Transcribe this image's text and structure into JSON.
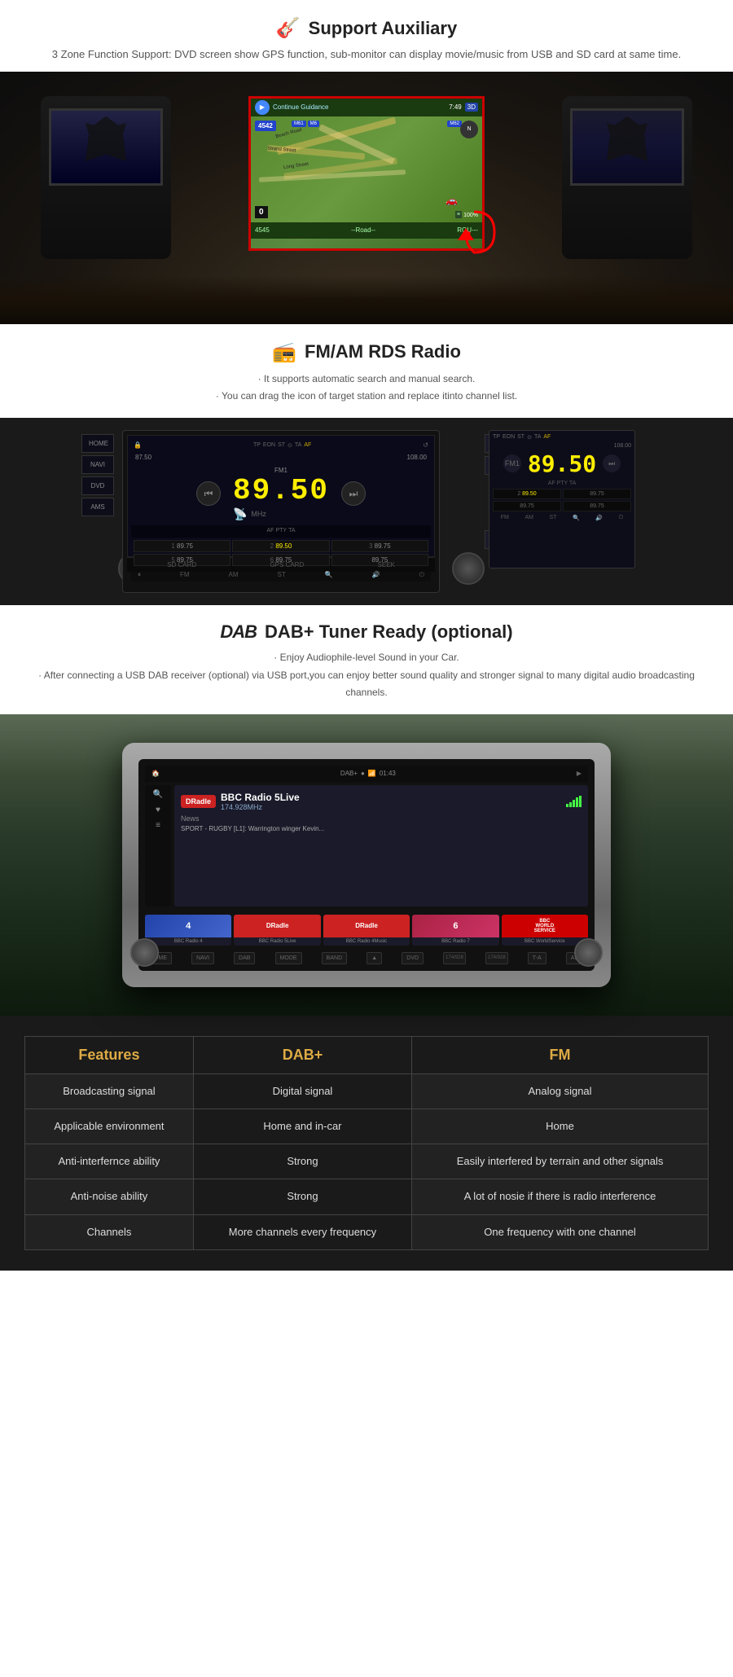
{
  "support_aux": {
    "icon": "🎸",
    "title": "Support Auxiliary",
    "description": "3 Zone Function Support: DVD screen show GPS function, sub-monitor can display\nmovie/music from USB and SD card at same time."
  },
  "radio": {
    "icon": "📻",
    "title": "FM/AM RDS Radio",
    "bullet1": "· It supports automatic search and manual search.",
    "bullet2": "· You can drag the icon of target station and replace itinto channel list.",
    "freq_left": "87.50",
    "freq_right": "108.00",
    "freq_main": "89.50",
    "band": "FM1",
    "mhz": "MHz",
    "presets": [
      {
        "num": "1",
        "val": "89.75"
      },
      {
        "num": "2",
        "val": "89.50",
        "active": true
      },
      {
        "num": "3",
        "val": "89.75"
      },
      {
        "num": "5",
        "val": "89.75"
      },
      {
        "num": "6",
        "val": "89.75"
      },
      {
        "num": "",
        "val": "89.75"
      }
    ],
    "indicators": [
      "TP",
      "EON",
      "ST",
      "⊙",
      "TA",
      "AF"
    ],
    "side_btns": [
      "BAND",
      "MODE",
      "PLAY"
    ],
    "left_btns": [
      "HOME",
      "NAVI",
      "DVD",
      "AMS"
    ],
    "bottom_btns": [
      "SD CARD",
      "GPS CARD",
      "SEEK"
    ],
    "bottom_icons": [
      "FM",
      "AM",
      "ST",
      "🔍",
      "🔊",
      "⏻"
    ]
  },
  "dab": {
    "icon_text": "DAB",
    "title": "DAB+ Tuner Ready (optional)",
    "bullet1": "· Enjoy Audiophile-level Sound in your Car.",
    "bullet2": "· After connecting a USB DAB receiver (optional) via USB port,you can enjoy better sound\nquality and stronger signal to many digital audio broadcasting channels.",
    "station": "BBC Radio 5Live",
    "freq": "174.928MHz",
    "genre": "News",
    "sport_text": "SPORT - RUGBY [L1]: Warrington winger Kevin...",
    "channels": [
      {
        "name": "BBC Radio 4",
        "label": "4",
        "class": "ch-bbc4"
      },
      {
        "name": "BBC Radio 5Live",
        "label": "DRadle",
        "class": "ch-dab1"
      },
      {
        "name": "BBC Radio 4Music",
        "label": "DRadle",
        "class": "ch-dab2"
      },
      {
        "name": "BBC Radio 7",
        "label": "6",
        "class": "ch-bbc6"
      },
      {
        "name": "BBC WorldService",
        "label": "BBC WORLD SERVICE",
        "class": "ch-bbcworld"
      }
    ],
    "ctrl_btns": [
      "HOME",
      "NAVI",
      "DAB",
      "MODE",
      "BAND",
      "▲",
      "DVD",
      "▼",
      "T-A",
      "AMS"
    ]
  },
  "comparison": {
    "header_features": "Features",
    "header_dab": "DAB+",
    "header_fm": "FM",
    "rows": [
      {
        "feature": "Broadcasting signal",
        "dab": "Digital signal",
        "fm": "Analog signal"
      },
      {
        "feature": "Applicable environment",
        "dab": "Home and in-car",
        "fm": "Home"
      },
      {
        "feature": "Anti-interfernce ability",
        "dab": "Strong",
        "fm": "Easily interfered by terrain and other signals"
      },
      {
        "feature": "Anti-noise ability",
        "dab": "Strong",
        "fm": "A lot of nosie if there is radio interference"
      },
      {
        "feature": "Channels",
        "dab": "More channels every frequency",
        "fm": "One frequency with one channel"
      }
    ]
  }
}
